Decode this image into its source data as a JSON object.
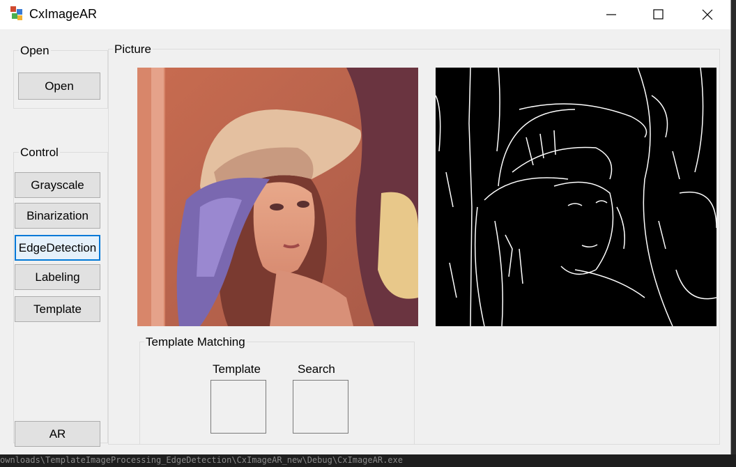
{
  "window": {
    "title": "CxImageAR"
  },
  "open_group": {
    "label": "Open",
    "open_button": "Open"
  },
  "control_group": {
    "label": "Control",
    "buttons": {
      "grayscale": "Grayscale",
      "binarization": "Binarization",
      "edge_detection": "EdgeDetection",
      "labeling": "Labeling",
      "template": "Template"
    },
    "ar_button": "AR"
  },
  "picture_group": {
    "label": "Picture"
  },
  "template_matching": {
    "label": "Template Matching",
    "template_label": "Template",
    "search_label": "Search"
  },
  "taskbar": {
    "path_text": "ownloads\\TemplateImageProcessing_EdgeDetection\\CxImageAR_new\\Debug\\CxImageAR.exe"
  },
  "colors": {
    "window_bg": "#f0f0f0",
    "focus": "#0078d7",
    "button_bg": "#e1e1e1"
  },
  "icons": [
    "app-icon",
    "minimize-icon",
    "maximize-icon",
    "close-icon"
  ]
}
